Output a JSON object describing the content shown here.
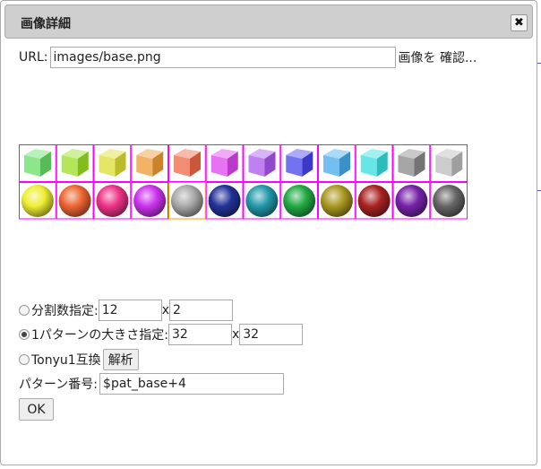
{
  "dialog": {
    "title": "画像詳細",
    "close_label": "✖"
  },
  "url": {
    "label": "URL:",
    "value": "images/base.png",
    "check_link": "画像を 確認..."
  },
  "options": {
    "split": {
      "label": "分割数指定:",
      "cols": "12",
      "x": "x",
      "rows": "2",
      "checked": false
    },
    "size": {
      "label": "1パターンの大きさ指定:",
      "w": "32",
      "x": "x",
      "h": "32",
      "checked": true
    },
    "tonyu": {
      "label": "Tonyu1互換",
      "analyze_button": "解析",
      "checked": false
    }
  },
  "pattern": {
    "label": "パターン番号:",
    "value": "$pat_base+4"
  },
  "ok_button": "OK",
  "sprites": {
    "cubes": [
      "#66dd66",
      "#99dd22",
      "#dddd33",
      "#ee9933",
      "#ee6644",
      "#dd44ee",
      "#aa55ee",
      "#4444ee",
      "#44aaee",
      "#33dddd",
      "#888888",
      "#bbbbbb"
    ],
    "balls": [
      "#eeee33",
      "#ee6633",
      "#ee3388",
      "#cc33ee",
      "#aaaaaa",
      "#223399",
      "#2299aa",
      "#22aa44",
      "#aa9922",
      "#aa2222",
      "#7722aa",
      "#666666"
    ],
    "selected_ball": 4
  }
}
